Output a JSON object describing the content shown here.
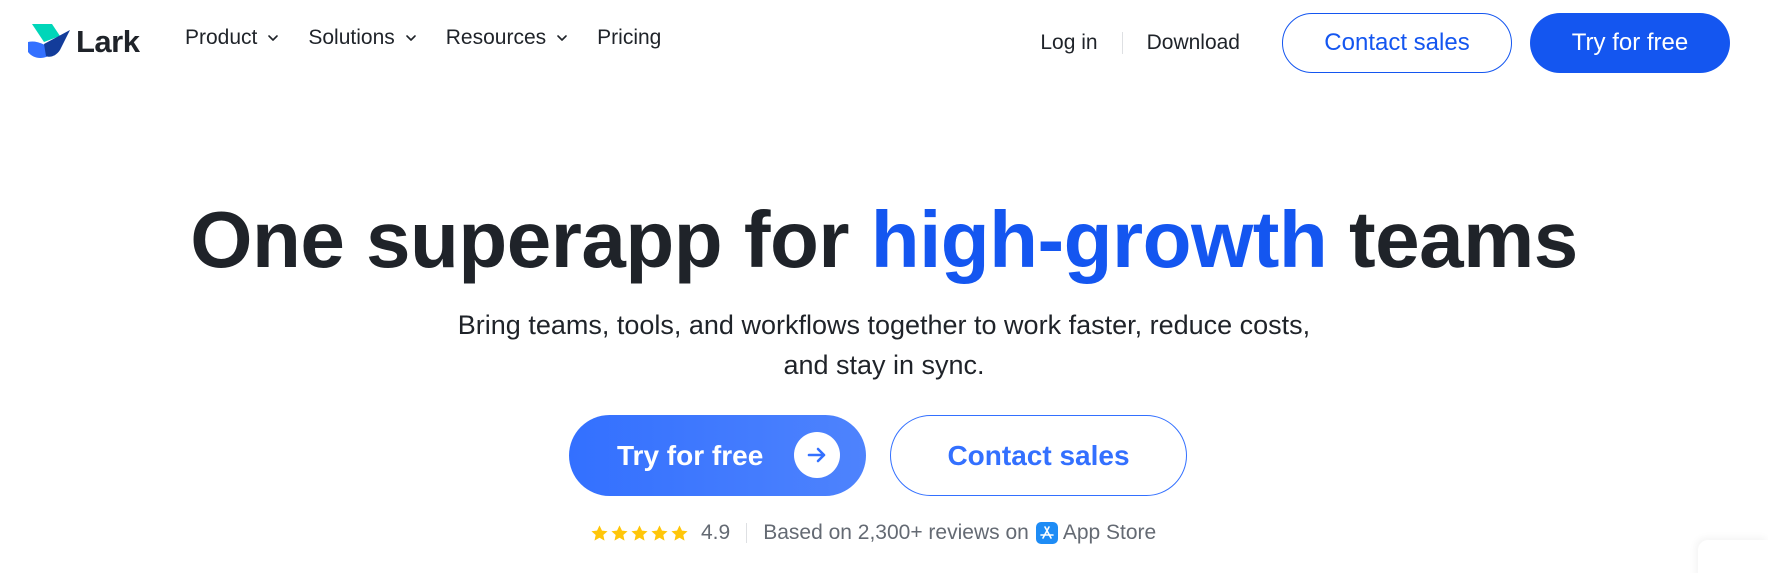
{
  "nav": {
    "brand": "Lark",
    "menu": [
      {
        "label": "Product",
        "dropdown": true
      },
      {
        "label": "Solutions",
        "dropdown": true
      },
      {
        "label": "Resources",
        "dropdown": true
      },
      {
        "label": "Pricing",
        "dropdown": false
      }
    ],
    "login": "Log in",
    "download": "Download",
    "contact_sales": "Contact sales",
    "try_free": "Try for free"
  },
  "hero": {
    "title_before": "One superapp for ",
    "title_highlight": "high-growth",
    "title_after": " teams",
    "subtitle_line1": "Bring teams, tools, and workflows together to work faster, reduce costs,",
    "subtitle_line2": "and stay in sync.",
    "cta_primary": "Try for free",
    "cta_secondary": "Contact sales"
  },
  "rating": {
    "stars": 5,
    "score": "4.9",
    "text_before": "Based on 2,300+ reviews on",
    "store": "App Store"
  },
  "colors": {
    "brand_blue": "#1456f0",
    "cta_blue": "#3370ff",
    "text_dark": "#1f2329",
    "text_gray": "#646a73",
    "star_yellow": "#ffc60a"
  }
}
